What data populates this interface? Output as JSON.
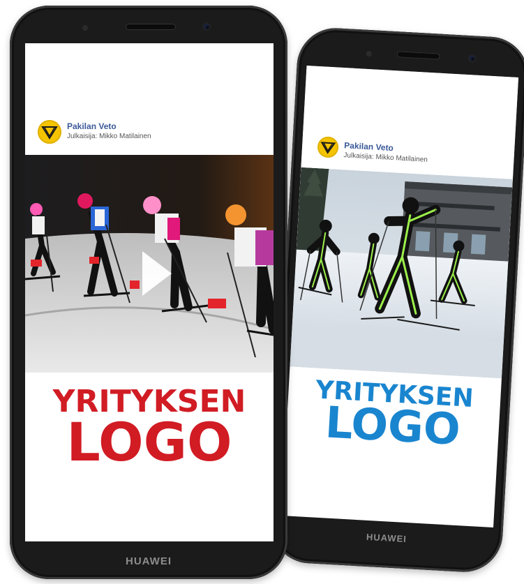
{
  "phones": [
    {
      "brand": "HUAWEI",
      "post": {
        "page_name": "Pakilan Veto",
        "publisher": "Julkaisija: Mikko Matilainen"
      },
      "media": {
        "type": "video",
        "icon": "play-icon",
        "scene": "night-ski-race-kids"
      },
      "logo": {
        "line1": "YRITYKSEN",
        "line2": "LOGO",
        "color": "#d11c24"
      }
    },
    {
      "brand": "HUAWEI",
      "post": {
        "page_name": "Pakilan Veto",
        "publisher": "Julkaisija: Mikko Matilainen"
      },
      "media": {
        "type": "image",
        "scene": "day-ski-skaters-neon-suits"
      },
      "logo": {
        "line1": "YRITYKSEN",
        "line2": "LOGO",
        "color": "#1a85cf"
      }
    }
  ],
  "colors": {
    "phone_body": "#1b1b1b",
    "link_blue": "#3b5998",
    "avatar_yellow": "#f5c400"
  }
}
